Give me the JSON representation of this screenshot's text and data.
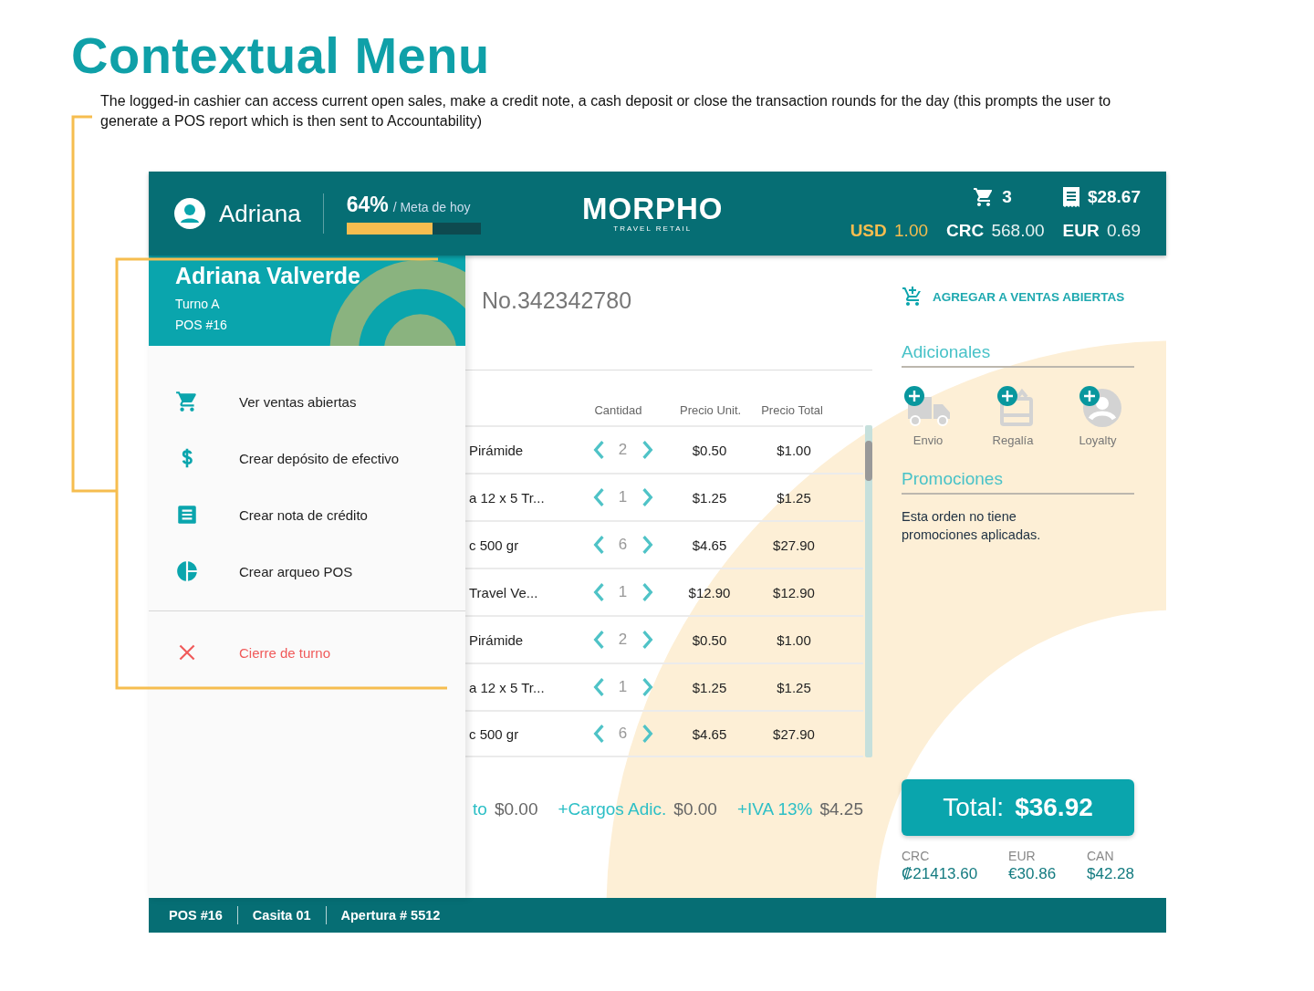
{
  "page": {
    "title": "Contextual Menu",
    "description": "The logged-in cashier can access current open sales, make a credit note, a cash deposit or close the transaction rounds for the day (this prompts the user to generate a POS report which is then sent to Accountability)"
  },
  "header": {
    "user": "Adriana",
    "goal": {
      "percent": "64%",
      "label": "/ Meta de hoy",
      "level": 0.64
    },
    "logo": {
      "name": "MORPHO",
      "tagline": "TRAVEL RETAIL"
    },
    "cart_count": "3",
    "receipt_total": "$28.67",
    "currencies": [
      {
        "code": "USD",
        "rate": "1.00",
        "selected": true
      },
      {
        "code": "CRC",
        "rate": "568.00",
        "selected": false
      },
      {
        "code": "EUR",
        "rate": "0.69",
        "selected": false
      }
    ]
  },
  "drawer": {
    "name": "Adriana Valverde",
    "shift": "Turno A",
    "pos": "POS #16",
    "items": [
      {
        "kind": "cart",
        "label": "Ver ventas abiertas"
      },
      {
        "kind": "dollar",
        "label": "Crear depósito de efectivo"
      },
      {
        "kind": "receipt",
        "label": "Crear nota de crédito"
      },
      {
        "kind": "pie",
        "label": "Crear arqueo POS"
      }
    ],
    "exit_item": {
      "label": "Cierre de turno"
    }
  },
  "order": {
    "number": "No.342342780",
    "columns": [
      "Cantidad",
      "Precio Unit.",
      "Precio Total"
    ],
    "rows": [
      {
        "product": "Pirámide",
        "quantity": "2",
        "unit_price": "$0.50",
        "total": "$1.00"
      },
      {
        "product": "a 12 x 5 Tr...",
        "quantity": "1",
        "unit_price": "$1.25",
        "total": "$1.25"
      },
      {
        "product": "c 500 gr",
        "quantity": "6",
        "unit_price": "$4.65",
        "total": "$27.90"
      },
      {
        "product": "Travel Ve...",
        "quantity": "1",
        "unit_price": "$12.90",
        "total": "$12.90"
      },
      {
        "product": "Pirámide",
        "quantity": "2",
        "unit_price": "$0.50",
        "total": "$1.00"
      },
      {
        "product": "a 12 x 5 Tr...",
        "quantity": "1",
        "unit_price": "$1.25",
        "total": "$1.25"
      },
      {
        "product": "c 500 gr",
        "quantity": "6",
        "unit_price": "$4.65",
        "total": "$27.90"
      }
    ],
    "summary": [
      {
        "label": "to",
        "value": "$0.00"
      },
      {
        "label": "+Cargos Adic.",
        "value": "$0.00"
      },
      {
        "label": "+IVA 13%",
        "value": "$4.25"
      }
    ]
  },
  "side": {
    "add_to_open_sales": "AGREGAR A VENTAS ABIERTAS",
    "extras_title": "Adicionales",
    "extras": [
      {
        "kind": "truck",
        "label": "Envio"
      },
      {
        "kind": "gift",
        "label": "Regalía"
      },
      {
        "kind": "person",
        "label": "Loyalty"
      }
    ],
    "promotions_title": "Promociones",
    "promotions_text": "Esta orden no tiene promociones aplicadas.",
    "total": {
      "label": "Total:",
      "value": "$36.92"
    },
    "conversions": [
      {
        "code": "CRC",
        "value": "₡21413.60"
      },
      {
        "code": "EUR",
        "value": "€30.86"
      },
      {
        "code": "CAN",
        "value": "$42.28"
      }
    ]
  },
  "status_bar": [
    "POS #16",
    "Casita 01",
    "Apertura # 5512"
  ]
}
